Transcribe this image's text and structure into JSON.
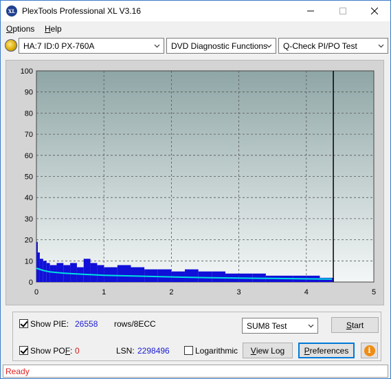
{
  "app": {
    "title": "PlexTools Professional XL V3.16",
    "icon_text": "XL"
  },
  "menu": {
    "options": {
      "mnemonic": "O",
      "rest": "ptions"
    },
    "help": {
      "mnemonic": "H",
      "rest": "elp"
    }
  },
  "toolbar": {
    "drive": "HA:7 ID:0  PX-760A",
    "function": "DVD Diagnostic Functions",
    "test": "Q-Check PI/PO Test"
  },
  "chart_data": {
    "type": "bar",
    "x_ticks": [
      "0",
      "1",
      "2",
      "3",
      "4",
      "5"
    ],
    "y_ticks": [
      "0",
      "10",
      "20",
      "30",
      "40",
      "50",
      "60",
      "70",
      "80",
      "90",
      "100"
    ],
    "xlim": [
      0,
      5
    ],
    "ylim": [
      0,
      100
    ],
    "grid": true,
    "end_marker_x": 4.4,
    "pie_bars": {
      "x": [
        0.0,
        0.02,
        0.05,
        0.1,
        0.15,
        0.2,
        0.3,
        0.4,
        0.5,
        0.6,
        0.7,
        0.8,
        0.9,
        1.0,
        1.2,
        1.4,
        1.6,
        1.8,
        2.0,
        2.2,
        2.4,
        2.6,
        2.8,
        3.0,
        3.2,
        3.4,
        3.6,
        3.8,
        4.0,
        4.2,
        4.38
      ],
      "values": [
        19,
        14,
        11,
        10,
        9,
        8,
        9,
        8,
        9,
        7,
        11,
        9,
        8,
        7,
        8,
        7,
        6,
        6,
        5,
        6,
        5,
        5,
        4,
        4,
        4,
        3,
        3,
        3,
        3,
        2,
        2
      ]
    },
    "average_line": {
      "x": [
        0,
        0.1,
        0.2,
        0.4,
        0.6,
        0.8,
        1.0,
        1.5,
        2.0,
        2.5,
        3.0,
        3.5,
        4.0,
        4.38
      ],
      "values": [
        6.5,
        5.5,
        4.8,
        4.2,
        3.8,
        3.5,
        3.2,
        2.8,
        2.4,
        2.1,
        1.9,
        1.7,
        1.5,
        1.4
      ]
    },
    "colors": {
      "bars": "#1010d8",
      "average": "#00e0e0",
      "marker": "#000000"
    }
  },
  "controls": {
    "show_pie_label": "Show PIE:",
    "pie_value": "26558",
    "pie_unit": "rows/8ECC",
    "show_pof_label_pre": "Show PO",
    "show_pof_label_ul": "F",
    "show_pof_label_post": ":",
    "pof_value": "0",
    "lsn_label": "LSN:",
    "lsn_value": "2298496",
    "logarithmic_label": "Logarithmic",
    "test_mode": "SUM8 Test",
    "start": {
      "mnemonic": "S",
      "rest": "tart"
    },
    "view_log": {
      "mnemonic": "V",
      "rest": "iew Log"
    },
    "preferences": {
      "mnemonic": "P",
      "rest": "references"
    }
  },
  "status": {
    "text": "Ready"
  }
}
